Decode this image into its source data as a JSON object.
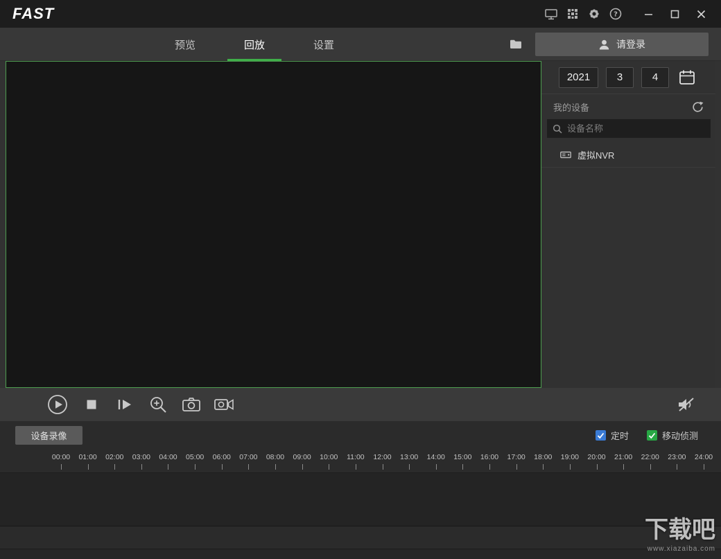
{
  "titlebar": {
    "logo": "FAST"
  },
  "tabs": [
    {
      "label": "预览"
    },
    {
      "label": "回放"
    },
    {
      "label": "设置"
    }
  ],
  "login": {
    "label": "请登录"
  },
  "date_picker": {
    "year": "2021",
    "month": "3",
    "day": "4"
  },
  "device_panel": {
    "title": "我的设备",
    "search_placeholder": "设备名称",
    "devices": [
      {
        "name": "虚拟NVR"
      }
    ]
  },
  "playback": {
    "record_type_label": "设备录像",
    "checkboxes": [
      {
        "label": "定时",
        "checked": true,
        "color": "#3a7bd5"
      },
      {
        "label": "移动侦测",
        "checked": true,
        "color": "#27a844"
      }
    ],
    "timeline_hours": [
      "00:00",
      "01:00",
      "02:00",
      "03:00",
      "04:00",
      "05:00",
      "06:00",
      "07:00",
      "08:00",
      "09:00",
      "10:00",
      "11:00",
      "12:00",
      "13:00",
      "14:00",
      "15:00",
      "16:00",
      "17:00",
      "18:00",
      "19:00",
      "20:00",
      "21:00",
      "22:00",
      "23:00",
      "24:00"
    ]
  },
  "watermark": {
    "title": "下载吧",
    "subtitle": "www.xiazaiba.com"
  },
  "icons": {
    "titlebar": [
      "monitor-icon",
      "qr-code-icon",
      "gear-icon",
      "help-icon"
    ],
    "toolbar": [
      "play-icon",
      "stop-icon",
      "frame-step-icon",
      "zoom-in-icon",
      "snapshot-icon",
      "record-icon",
      "mute-icon"
    ]
  },
  "colors": {
    "accent_green": "#3fae49",
    "video_border": "#4e9e50",
    "checkbox_timed": "#3a7bd5",
    "checkbox_motion": "#27a844"
  }
}
